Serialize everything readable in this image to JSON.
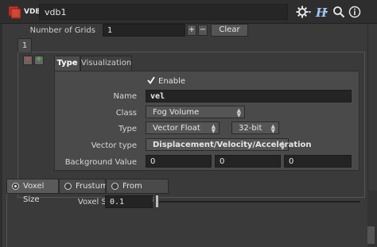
{
  "header": {
    "node_type_label": "VDB",
    "node_name": "vdb1",
    "icons": [
      "gear-icon",
      "help-icon",
      "search-icon",
      "info-icon"
    ]
  },
  "grids": {
    "label": "Number of Grids",
    "value": "1",
    "add_label": "+",
    "remove_label": "−",
    "clear_label": "Clear",
    "instance_tab": "1"
  },
  "instance": {
    "remove_label": "×",
    "add_label": "+",
    "tabs": [
      "Type",
      "Visualization"
    ],
    "enable_label": "Enable",
    "name_label": "Name",
    "name_value": "vel",
    "class_label": "Class",
    "class_value": "Fog Volume",
    "type_label": "Type",
    "type_value": "Vector Float",
    "precision_value": "32-bit",
    "vector_type_label": "Vector type",
    "vector_type_value": "Displacement/Velocity/Acceleration",
    "background_label": "Background Value",
    "background_values": [
      "0",
      "0",
      "0"
    ]
  },
  "voxel": {
    "modes": [
      "Voxel Size",
      "Frustum",
      "From Camera"
    ],
    "selected_mode": "Voxel Size",
    "voxel_size_label": "Voxel Size",
    "voxel_size_value": "0.1",
    "slider_fraction": 0.0
  },
  "colors": {
    "vdb_icon": "#c0392b",
    "remove_red": "#e34040",
    "add_green": "#4ec24e",
    "help_blue": "#9fc6ff"
  }
}
